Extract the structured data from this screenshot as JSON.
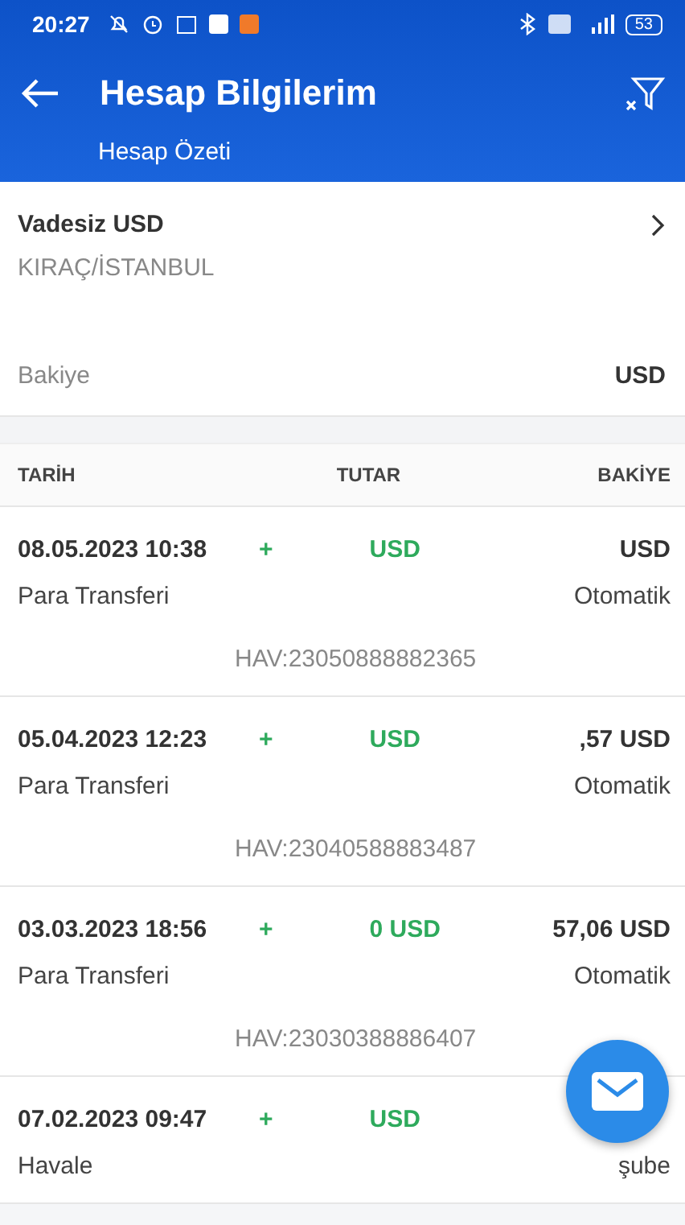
{
  "status_bar": {
    "time": "20:27",
    "battery": "53"
  },
  "header": {
    "title": "Hesap Bilgilerim",
    "subtitle": "Hesap Özeti"
  },
  "account": {
    "name": "Vadesiz USD",
    "branch": "KIRAÇ/İSTANBUL",
    "balance_label": "Bakiye",
    "balance": "USD"
  },
  "table": {
    "columns": [
      "TARİH",
      "TUTAR",
      "BAKİYE"
    ],
    "rows": [
      {
        "date": "08.05.2023 10:38",
        "amount_sign": "+",
        "amount": "USD",
        "balance": "USD",
        "type": "Para Transferi",
        "channel": "Otomatik",
        "description": "HAV:23050888882365"
      },
      {
        "date": "05.04.2023 12:23",
        "amount_sign": "+",
        "amount": "USD",
        "balance": ",57 USD",
        "type": "Para Transferi",
        "channel": "Otomatik",
        "description": "HAV:23040588883487"
      },
      {
        "date": "03.03.2023 18:56",
        "amount_sign": "+",
        "amount": "0 USD",
        "balance": "57,06 USD",
        "type": "Para Transferi",
        "channel": "Otomatik",
        "description": "HAV:23030388886407"
      },
      {
        "date": "07.02.2023 09:47",
        "amount_sign": "+",
        "amount": "USD",
        "type": "Havale",
        "channel": "şube"
      }
    ]
  }
}
